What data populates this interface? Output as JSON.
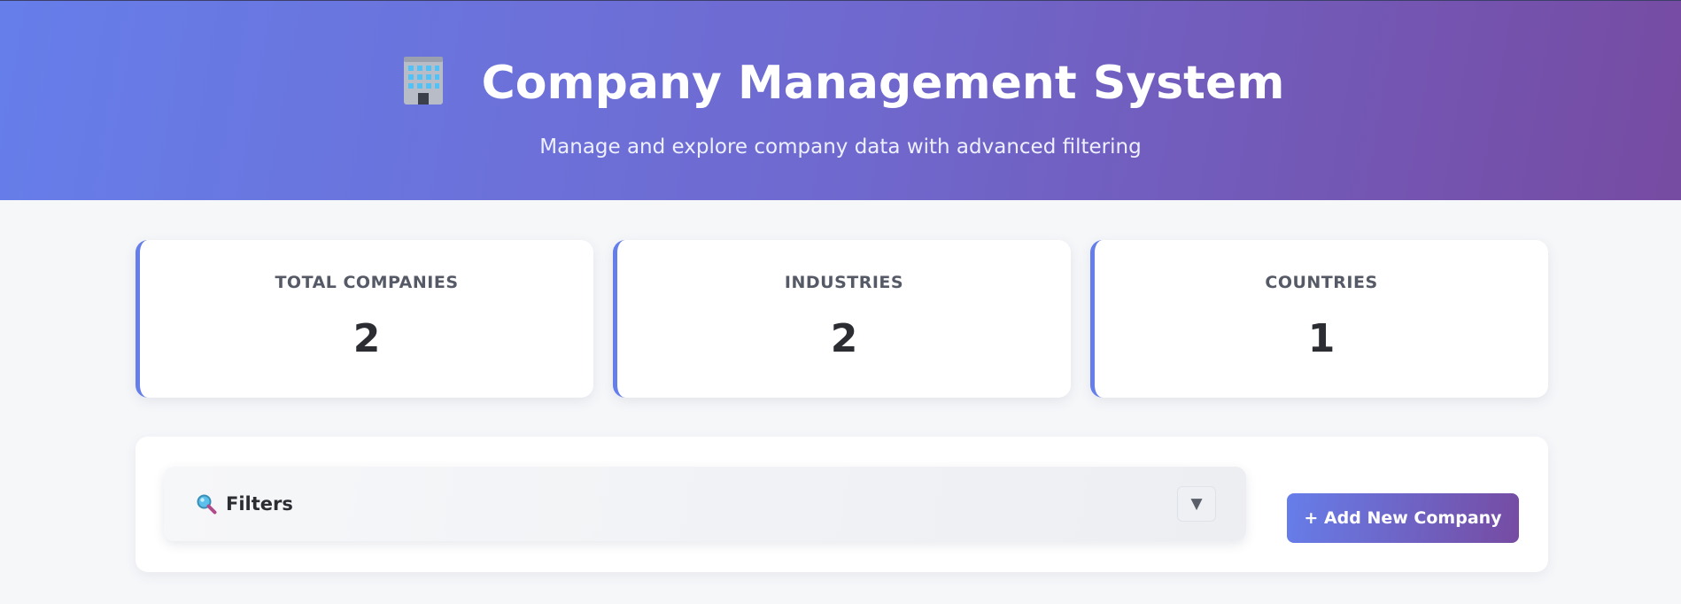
{
  "header": {
    "title": "Company Management System",
    "subtitle": "Manage and explore company data with advanced filtering",
    "icon": "office-building-icon"
  },
  "stats": [
    {
      "label": "TOTAL COMPANIES",
      "value": "2"
    },
    {
      "label": "INDUSTRIES",
      "value": "2"
    },
    {
      "label": "COUNTRIES",
      "value": "1"
    }
  ],
  "filters": {
    "label": "Filters",
    "icon": "search-icon",
    "toggle_glyph": "▼"
  },
  "actions": {
    "add_label": "+ Add New Company"
  },
  "colors": {
    "accent_start": "#667eea",
    "accent_end": "#764ba2",
    "background": "#f6f7f9"
  }
}
